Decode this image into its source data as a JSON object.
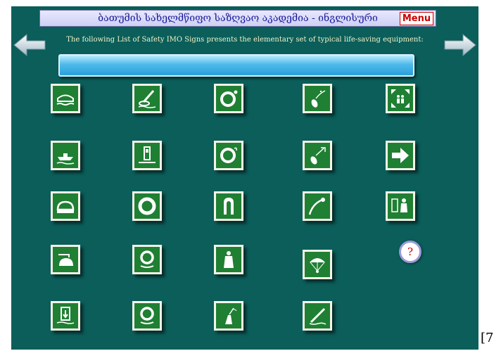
{
  "header": {
    "title": "ბათუმის სახელმწიფო საზღვაო აკადემია - ინგლისური",
    "menu_label": "Menu"
  },
  "subtitle": "The following List of Safety IMO Signs presents the elementary set of typical life-saving equipment:",
  "nav": {
    "prev_icon": "left-arrow-icon",
    "next_icon": "right-arrow-icon"
  },
  "signs": [
    {
      "icon": "liferaft-icon"
    },
    {
      "icon": "rescue-slide-icon"
    },
    {
      "icon": "lifebuoy-with-light-icon"
    },
    {
      "icon": "line-throwing-appliance-icon"
    },
    {
      "icon": "muster-station-icon"
    },
    {
      "icon": "rescue-boat-icon"
    },
    {
      "icon": "evacuation-slide-icon"
    },
    {
      "icon": "lifebuoy-with-light-smoke-icon"
    },
    {
      "icon": "rocket-parachute-flare-icon"
    },
    {
      "icon": "exit-direction-icon"
    },
    {
      "icon": "enclosed-lifeboat-icon"
    },
    {
      "icon": "lifebuoy-icon"
    },
    {
      "icon": "lifejacket-icon"
    },
    {
      "icon": "distress-signal-icon"
    },
    {
      "icon": "immersion-suit-icon"
    },
    {
      "icon": "davit-launched-liferaft-icon"
    },
    {
      "icon": "lifebuoy-with-line-icon"
    },
    {
      "icon": "thermal-protective-aid-icon"
    },
    {
      "icon": "parachute-signal-icon"
    },
    {
      "icon": "embarkation-ladder-icon"
    },
    {
      "icon": "lifebuoy-with-line-2-icon"
    },
    {
      "icon": "radio-beacon-icon"
    },
    {
      "icon": "line-throwing-apparatus-icon"
    }
  ],
  "help_label": "?",
  "footer_fragment": "[7",
  "colors": {
    "stage_background": "#0b5e5a",
    "sign_green": "#1f7f33",
    "sign_border": "#f4f4e8",
    "menu_red": "#cc0000",
    "title_blue": "#1a1a9a"
  }
}
